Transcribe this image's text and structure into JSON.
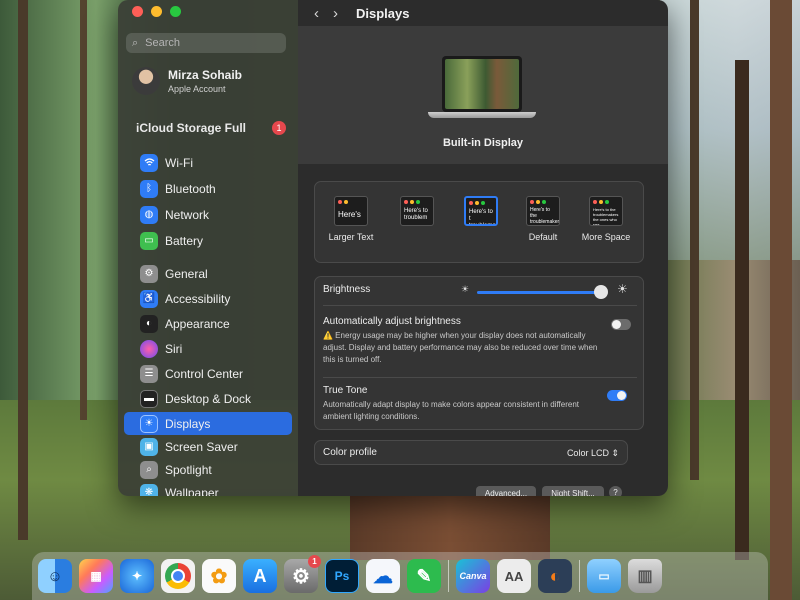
{
  "sidebar": {
    "search_placeholder": "Search",
    "account": {
      "name": "Mirza Sohaib",
      "subtitle": "Apple Account"
    },
    "icloud": {
      "label": "iCloud Storage Full",
      "badge": "1"
    },
    "items_group1": [
      {
        "label": "Wi-Fi",
        "icon": "wifi-icon",
        "color": "#2f7cf6"
      },
      {
        "label": "Bluetooth",
        "icon": "bluetooth-icon",
        "color": "#2f7cf6"
      },
      {
        "label": "Network",
        "icon": "globe-icon",
        "color": "#2f7cf6"
      },
      {
        "label": "Battery",
        "icon": "battery-icon",
        "color": "#3fbf4f"
      }
    ],
    "items_group2": [
      {
        "label": "General",
        "icon": "gear-icon",
        "color": "#8e8e8e"
      },
      {
        "label": "Accessibility",
        "icon": "accessibility-icon",
        "color": "#2f7cf6"
      },
      {
        "label": "Appearance",
        "icon": "appearance-icon",
        "color": "#222222"
      },
      {
        "label": "Siri",
        "icon": "siri-icon",
        "color": "#b64ee0"
      },
      {
        "label": "Control Center",
        "icon": "control-center-icon",
        "color": "#8e8e8e"
      },
      {
        "label": "Desktop & Dock",
        "icon": "desktop-dock-icon",
        "color": "#222222"
      },
      {
        "label": "Displays",
        "icon": "displays-icon",
        "color": "#2f7cf6",
        "selected": true
      },
      {
        "label": "Screen Saver",
        "icon": "screen-saver-icon",
        "color": "#4fb3e8"
      },
      {
        "label": "Spotlight",
        "icon": "spotlight-icon",
        "color": "#8e8e8e"
      },
      {
        "label": "Wallpaper",
        "icon": "wallpaper-icon",
        "color": "#4fb3e8"
      }
    ]
  },
  "content": {
    "title": "Displays",
    "display_name": "Built-in Display",
    "resolutions": [
      {
        "label": "Larger Text",
        "preview": "Here's"
      },
      {
        "label": "",
        "preview": "Here's to troublem"
      },
      {
        "label": "",
        "preview": "Here's to t troublema ones who",
        "selected": true
      },
      {
        "label": "Default",
        "preview": "Here's to the troublemakers ones who see"
      },
      {
        "label": "More Space",
        "preview": "Here's to the troublemakers the ones who see"
      }
    ],
    "brightness_label": "Brightness",
    "brightness_value": 0.95,
    "auto_brightness": {
      "title": "Automatically adjust brightness",
      "warning": "⚠️ Energy usage may be higher when your display does not automatically adjust. Display and battery performance may also be reduced over time when this is turned off.",
      "enabled": false
    },
    "true_tone": {
      "title": "True Tone",
      "desc": "Automatically adapt display to make colors appear consistent in different ambient lighting conditions.",
      "enabled": true
    },
    "color_profile": {
      "label": "Color profile",
      "value": "Color LCD ⇕"
    },
    "buttons": {
      "advanced": "Advanced...",
      "night_shift": "Night Shift...",
      "help": "?"
    }
  },
  "dock": {
    "apps": [
      {
        "name": "finder-app",
        "color": "#3a8ee8",
        "glyph": "☺"
      },
      {
        "name": "launchpad-app",
        "color": "#e85a8a",
        "glyph": "▦"
      },
      {
        "name": "safari-app",
        "color": "#1e7de0",
        "glyph": "✦"
      },
      {
        "name": "chrome-app",
        "color": "#e8483a",
        "glyph": "◉"
      },
      {
        "name": "photos-app",
        "color": "#f5f5f5",
        "glyph": "✿"
      },
      {
        "name": "app-store-app",
        "color": "#1e88f0",
        "glyph": "A"
      },
      {
        "name": "system-settings-app",
        "color": "#7a7a7a",
        "glyph": "⚙",
        "badge": "1"
      },
      {
        "name": "photoshop-app",
        "color": "#0b1c3a",
        "glyph": "Ps"
      },
      {
        "name": "onedrive-app",
        "color": "#f2f4f8",
        "glyph": "☁"
      },
      {
        "name": "pen-app",
        "color": "#2dbb4e",
        "glyph": "✎"
      },
      {
        "name": "canva-app",
        "color": "#22b4c8",
        "glyph": "Canva"
      },
      {
        "name": "font-book-app",
        "color": "#e8e8e8",
        "glyph": "AA"
      },
      {
        "name": "blender-app",
        "color": "#2a3a55",
        "glyph": "◐"
      },
      {
        "name": "folder-app",
        "color": "#5ab0ee",
        "glyph": "▭"
      },
      {
        "name": "trash-app",
        "color": "#bdbdbd",
        "glyph": "🗑"
      }
    ]
  }
}
